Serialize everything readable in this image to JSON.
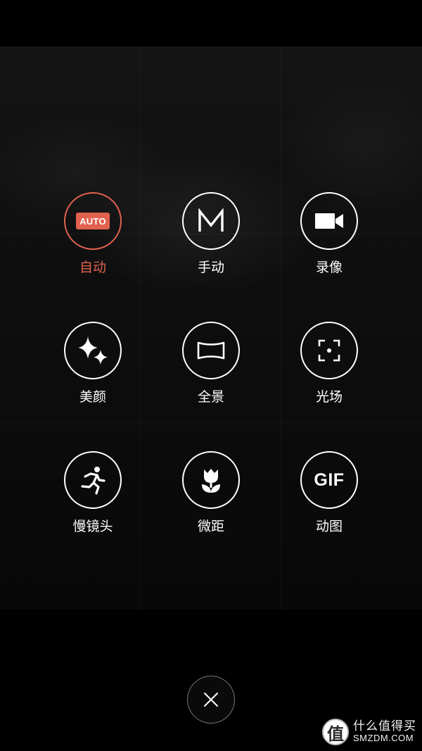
{
  "modes": [
    {
      "id": "auto",
      "label": "自动",
      "badge_text": "AUTO",
      "icon": "auto-badge-icon",
      "selected": true
    },
    {
      "id": "manual",
      "label": "手动",
      "glyph": "M",
      "icon": "manual-m-icon",
      "selected": false
    },
    {
      "id": "video",
      "label": "录像",
      "icon": "video-camera-icon",
      "selected": false
    },
    {
      "id": "beauty",
      "label": "美颜",
      "icon": "sparkle-icon",
      "selected": false
    },
    {
      "id": "panorama",
      "label": "全景",
      "icon": "panorama-icon",
      "selected": false
    },
    {
      "id": "lightfield",
      "label": "光场",
      "icon": "focus-frame-icon",
      "selected": false
    },
    {
      "id": "slowmo",
      "label": "慢镜头",
      "icon": "running-person-icon",
      "selected": false
    },
    {
      "id": "macro",
      "label": "微距",
      "icon": "tulip-macro-icon",
      "selected": false
    },
    {
      "id": "gif",
      "label": "动图",
      "glyph": "GIF",
      "icon": "gif-icon",
      "selected": false
    }
  ],
  "close": {
    "icon": "close-icon"
  },
  "watermark": {
    "logo_char": "值",
    "cn": "什么值得买",
    "en": "SMZDM.COM"
  },
  "colors": {
    "accent": "#e1614f",
    "icon": "#ffffff",
    "background": "#000000"
  }
}
